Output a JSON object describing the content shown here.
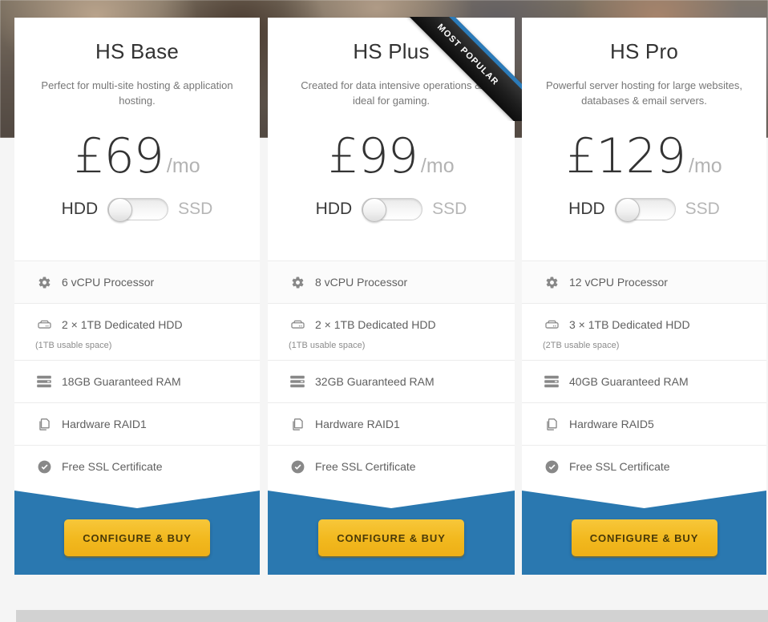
{
  "page": {
    "background_color": "#f5f5f5",
    "accent_blue": "#2a78b0",
    "cta_color": "#f2b91f",
    "ribbon_color": "#1f1f1f"
  },
  "plans": [
    {
      "name": "HS Base",
      "description": "Perfect for multi-site hosting & application hosting.",
      "currency": "£",
      "price": "69",
      "price_display": "£69",
      "period": "/mo",
      "storage_toggle": {
        "left_label": "HDD",
        "right_label": "SSD",
        "selected": "HDD"
      },
      "features": [
        {
          "icon": "gear-icon",
          "value": "6",
          "unit": "vCPU",
          "text": "6 vCPU Processor",
          "sub": ""
        },
        {
          "icon": "hdd-icon",
          "value": "2",
          "unit": "",
          "text": "2 × 1TB Dedicated HDD",
          "sub": "(1TB usable space)"
        },
        {
          "icon": "ram-icon",
          "value": "18",
          "unit": "GB",
          "text": "18GB Guaranteed RAM",
          "sub": ""
        },
        {
          "icon": "raid-icon",
          "value": "",
          "unit": "",
          "text": "Hardware RAID1",
          "sub": ""
        },
        {
          "icon": "check-circle-icon",
          "value": "",
          "unit": "",
          "text": "Free SSL Certificate",
          "sub": ""
        }
      ],
      "cta_label": "CONFIGURE & BUY",
      "badge": null
    },
    {
      "name": "HS Plus",
      "description": "Created for data intensive operations & ideal for gaming.",
      "currency": "£",
      "price": "99",
      "price_display": "£99",
      "period": "/mo",
      "storage_toggle": {
        "left_label": "HDD",
        "right_label": "SSD",
        "selected": "HDD"
      },
      "features": [
        {
          "icon": "gear-icon",
          "value": "8",
          "unit": "vCPU",
          "text": "8 vCPU Processor",
          "sub": ""
        },
        {
          "icon": "hdd-icon",
          "value": "2",
          "unit": "",
          "text": "2 × 1TB Dedicated HDD",
          "sub": "(1TB usable space)"
        },
        {
          "icon": "ram-icon",
          "value": "32",
          "unit": "GB",
          "text": "32GB Guaranteed RAM",
          "sub": ""
        },
        {
          "icon": "raid-icon",
          "value": "",
          "unit": "",
          "text": "Hardware RAID1",
          "sub": ""
        },
        {
          "icon": "check-circle-icon",
          "value": "",
          "unit": "",
          "text": "Free SSL Certificate",
          "sub": ""
        }
      ],
      "cta_label": "CONFIGURE & BUY",
      "badge": "MOST POPULAR"
    },
    {
      "name": "HS Pro",
      "description": "Powerful server hosting for large websites, databases & email servers.",
      "currency": "£",
      "price": "129",
      "price_display": "£129",
      "period": "/mo",
      "storage_toggle": {
        "left_label": "HDD",
        "right_label": "SSD",
        "selected": "HDD"
      },
      "features": [
        {
          "icon": "gear-icon",
          "value": "12",
          "unit": "vCPU",
          "text": "12 vCPU Processor",
          "sub": ""
        },
        {
          "icon": "hdd-icon",
          "value": "3",
          "unit": "",
          "text": "3 × 1TB Dedicated HDD",
          "sub": "(2TB usable space)"
        },
        {
          "icon": "ram-icon",
          "value": "40",
          "unit": "GB",
          "text": "40GB Guaranteed RAM",
          "sub": ""
        },
        {
          "icon": "raid-icon",
          "value": "",
          "unit": "",
          "text": "Hardware RAID5",
          "sub": ""
        },
        {
          "icon": "check-circle-icon",
          "value": "",
          "unit": "",
          "text": "Free SSL Certificate",
          "sub": ""
        }
      ],
      "cta_label": "CONFIGURE & BUY",
      "badge": null
    }
  ]
}
